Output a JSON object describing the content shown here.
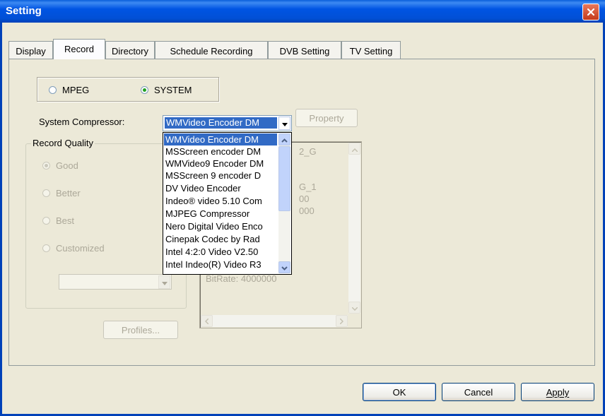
{
  "window": {
    "title": "Setting"
  },
  "tabs": [
    {
      "label": "Display"
    },
    {
      "label": "Record"
    },
    {
      "label": "Directory"
    },
    {
      "label": "Schedule Recording"
    },
    {
      "label": "DVB Setting"
    },
    {
      "label": "TV Setting"
    }
  ],
  "active_tab": "Record",
  "format": {
    "mpeg_label": "MPEG",
    "system_label": "SYSTEM",
    "selected": "SYSTEM"
  },
  "compressor": {
    "label": "System Compressor:",
    "selected": "WMVideo Encoder DM",
    "property_label": "Property",
    "options": [
      "WMVideo Encoder DM",
      "MSScreen encoder DM",
      "WMVideo9 Encoder DM",
      "MSScreen 9 encoder D",
      "DV Video Encoder",
      "Indeo® video 5.10 Com",
      "MJPEG Compressor",
      "Nero Digital Video Enco",
      "Cinepak Codec by Rad",
      "Intel 4:2:0 Video V2.50",
      "Intel Indeo(R) Video R3"
    ]
  },
  "record_quality": {
    "label": "Record Quality",
    "options": [
      "Good",
      "Better",
      "Best",
      "Customized"
    ],
    "selected": "Good",
    "profiles_label": "Profiles..."
  },
  "info_panel": {
    "lines": [
      "2_G",
      "G_1",
      "00",
      "000",
      "BitRate:   4000000"
    ]
  },
  "footer": {
    "ok": "OK",
    "cancel": "Cancel",
    "apply": "Apply"
  },
  "colors": {
    "title_bar": "#0054E3",
    "highlight": "#316AC5",
    "dialog_bg": "#ECE9D8",
    "close_button": "#D4502E"
  }
}
